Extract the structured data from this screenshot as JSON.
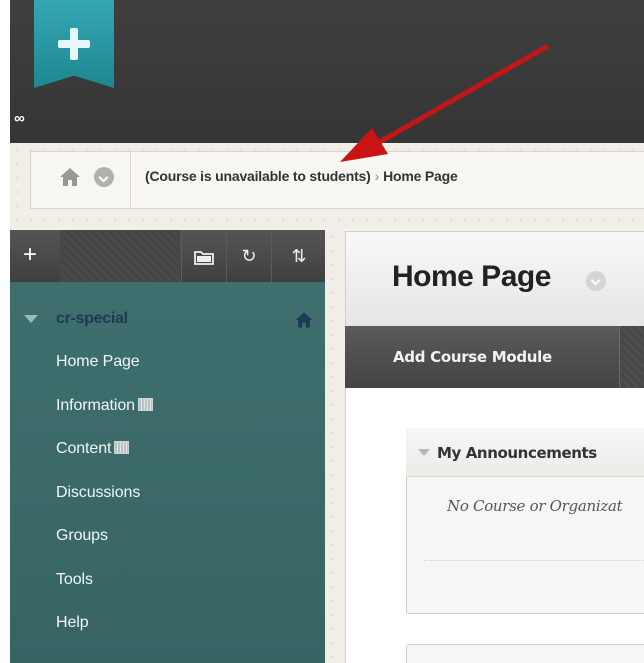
{
  "breadcrumb": {
    "course": "(Course is unavailable to students)",
    "separator": "›",
    "current": "Home Page"
  },
  "sidebar": {
    "add_label": "+",
    "tools": [
      "folder-icon",
      "refresh-icon",
      "sort-icon"
    ],
    "course_name": "cr-special",
    "items": [
      {
        "label": "Home Page",
        "icon": ""
      },
      {
        "label": "Information",
        "icon": "content-badge-icon"
      },
      {
        "label": "Content",
        "icon": "content-badge-icon"
      },
      {
        "label": "Discussions",
        "icon": ""
      },
      {
        "label": "Groups",
        "icon": ""
      },
      {
        "label": "Tools",
        "icon": ""
      },
      {
        "label": "Help",
        "icon": ""
      }
    ]
  },
  "main": {
    "page_title": "Home Page",
    "action_button": "Add Course Module",
    "module": {
      "title": "My Announcements",
      "body": "No Course or Organizat"
    }
  },
  "colors": {
    "brand_teal": "#1e8791",
    "sidebar": "#3c6c6b",
    "annotation_arrow": "#c81414"
  }
}
